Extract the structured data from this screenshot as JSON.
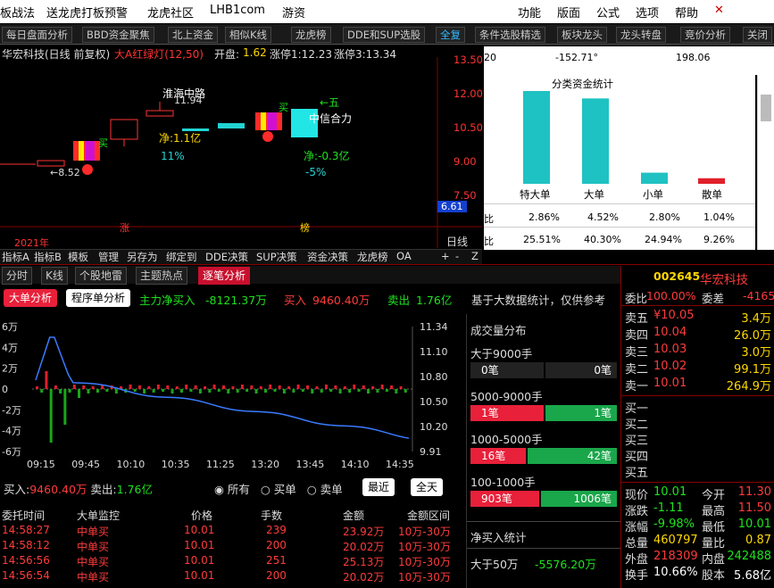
{
  "menu": {
    "items_left": [
      "板战法",
      "送龙虎打板预警",
      "龙虎社区",
      "LHB1com",
      "游资"
    ],
    "items_right": [
      "功能",
      "版面",
      "公式",
      "选项",
      "帮助"
    ],
    "window_close": "✕"
  },
  "tabs": [
    "每日盘面分析",
    "BBD资金聚焦",
    "北上资金",
    "相似K线",
    "龙虎榜",
    "DDE和SUP选股",
    "全复",
    "条件选股精选",
    "板块龙头",
    "龙头转盘",
    "竞价分析",
    "关闭"
  ],
  "kchart": {
    "header": "华宏科技(日线 前复权)",
    "indicator": "大A红绿灯(12,50)",
    "open_label": "开盘:",
    "open_value": "1.62",
    "stop1": "涨停1:12.23",
    "stop2": "涨停3:13.34",
    "yaxis": [
      "13.50",
      "12.00",
      "10.50",
      "9.00",
      "7.50"
    ],
    "ycurrent": "6.61",
    "year": "2021年",
    "labels": {
      "zhang": "涨",
      "bang": "榜",
      "minval": "←8.52",
      "maxval": "11.94",
      "buy1": "买",
      "buy2": "买",
      "five": "←五",
      "concept1": "淮海中路",
      "concept2": "中信合力",
      "net1": "净:1.1亿",
      "pct1": "11%",
      "net2": "净:-0.3亿",
      "pct2": "-5%",
      "rixian": "日线"
    }
  },
  "rightpanel": {
    "top_values": [
      "20",
      "-152.71°",
      "198.06"
    ],
    "title": "分类资金统计",
    "categories": [
      "特大单",
      "大单",
      "小单",
      "散单"
    ],
    "row1": [
      "2.86%",
      "4.52%",
      "2.80%",
      "1.04%"
    ],
    "row2": [
      "25.51%",
      "40.30%",
      "24.94%",
      "9.26%"
    ],
    "bar_values": [
      100,
      92,
      12,
      6
    ]
  },
  "toolbar2": [
    "指标A",
    "指标B",
    "模板",
    "管理",
    "另存为",
    "绑定到",
    "DDE决策",
    "SUP决策",
    "资金决策",
    "龙虎榜",
    "OA",
    "+",
    "-",
    "Z"
  ],
  "lowertabs": [
    "分时",
    "K线",
    "个股地雷",
    "主题热点",
    "逐笔分析"
  ],
  "orders": {
    "btn1": "大单分析",
    "btn2": "程序单分析",
    "net_label": "主力净买入",
    "net_value": "-8121.37万",
    "buy_label": "买入",
    "buy_value": "9460.40万",
    "sell_label": "卖出",
    "sell_value": "1.76亿",
    "hint": "基于大数据统计，仅供参考"
  },
  "flowchart": {
    "yleft": [
      "6万",
      "4万",
      "2万",
      "0",
      "-2万",
      "-4万",
      "-6万"
    ],
    "yright": [
      "11.34",
      "11.10",
      "10.80",
      "10.50",
      "10.20",
      "9.91"
    ],
    "xlabels": [
      "09:15",
      "09:45",
      "10:10",
      "10:35",
      "11:25",
      "13:20",
      "13:45",
      "14:10",
      "14:35"
    ],
    "buy_label": "买入:",
    "buy_value": "9460.40万",
    "sell_label": "卖出:",
    "sell_value": "1.76亿",
    "radio": [
      "所有",
      "买单",
      "卖单"
    ],
    "btn_recent": "最近",
    "btn_all": "全天"
  },
  "dist": {
    "title": "成交量分布",
    "groups": [
      {
        "label": "大于9000手",
        "left": "0笔",
        "right": "0笔",
        "lfrac": 0.5
      },
      {
        "label": "5000-9000手",
        "left": "1笔",
        "right": "1笔",
        "lfrac": 0.5
      },
      {
        "label": "1000-5000手",
        "left": "16笔",
        "right": "42笔",
        "lfrac": 0.38
      },
      {
        "label": "100-1000手",
        "left": "903笔",
        "right": "1006笔",
        "lfrac": 0.47
      }
    ],
    "net_title": "净买入统计",
    "net_label": "大于50万",
    "net_value": "-5576.20万"
  },
  "deals": {
    "headers": [
      "委托时间",
      "大单监控",
      "价格",
      "手数",
      "金额",
      "金额区间"
    ],
    "rows": [
      [
        "14:58:27",
        "中单买",
        "10.01",
        "239",
        "23.92万",
        "10万-30万"
      ],
      [
        "14:58:12",
        "中单买",
        "10.01",
        "200",
        "20.02万",
        "10万-30万"
      ],
      [
        "14:56:56",
        "中单买",
        "10.01",
        "251",
        "25.13万",
        "10万-30万"
      ],
      [
        "14:56:54",
        "中单买",
        "10.01",
        "200",
        "20.02万",
        "10万-30万"
      ]
    ]
  },
  "quotes": {
    "code": "002645",
    "name": "华宏科技",
    "weibi_label": "委比",
    "weibi": "100.00%",
    "weicha_label": "委差",
    "weicha": "-4165",
    "sells": [
      {
        "label": "卖五",
        "price": "¥10.05",
        "vol": "3.4万"
      },
      {
        "label": "卖四",
        "price": "10.04",
        "vol": "26.0万"
      },
      {
        "label": "卖三",
        "price": "10.03",
        "vol": "3.0万"
      },
      {
        "label": "卖二",
        "price": "10.02",
        "vol": "99.1万"
      },
      {
        "label": "卖一",
        "price": "10.01",
        "vol": "264.9万"
      }
    ],
    "buys": [
      "买一",
      "买二",
      "买三",
      "买四",
      "买五"
    ],
    "stats": [
      {
        "l1": "现价",
        "v1": "10.01",
        "c1": "g",
        "l2": "今开",
        "v2": "11.30",
        "c2": "r"
      },
      {
        "l1": "涨跌",
        "v1": "-1.11",
        "c1": "g",
        "l2": "最高",
        "v2": "11.50",
        "c2": "r"
      },
      {
        "l1": "涨幅",
        "v1": "-9.98%",
        "c1": "g",
        "l2": "最低",
        "v2": "10.01",
        "c2": "g"
      },
      {
        "l1": "总量",
        "v1": "460797",
        "c1": "y",
        "l2": "量比",
        "v2": "0.87",
        "c2": "y"
      },
      {
        "l1": "外盘",
        "v1": "218309",
        "c1": "r",
        "l2": "内盘",
        "v2": "242488",
        "c2": "g"
      },
      {
        "l1": "换手",
        "v1": "10.66%",
        "c1": "w",
        "l2": "股本",
        "v2": "5.68亿",
        "c2": "w"
      }
    ]
  },
  "colors": {
    "red": "#ff3b3b",
    "green": "#1ee31e",
    "yellow": "#ffd800",
    "cyan": "#22d3d3",
    "teal": "#1fb6b6"
  }
}
